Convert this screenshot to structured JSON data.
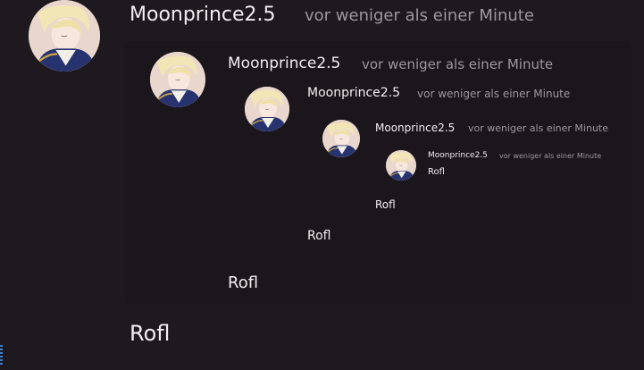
{
  "messages": [
    {
      "username": "Moonprince2.5",
      "timestamp": "vor weniger als einer Minute",
      "text": "Rofl"
    },
    {
      "username": "Moonprince2.5",
      "timestamp": "vor weniger als einer Minute",
      "text": "Rofl"
    },
    {
      "username": "Moonprince2.5",
      "timestamp": "vor weniger als einer Minute",
      "text": "Rofl"
    },
    {
      "username": "Moonprince2.5",
      "timestamp": "vor weniger als einer Minute",
      "text": "Rofl"
    },
    {
      "username": "Moonprince2.5",
      "timestamp": "vor weniger als einer Minute",
      "text": "Rofl"
    }
  ],
  "colors": {
    "background": "#1e191e",
    "username": "#f1eef1",
    "timestamp": "#9d97a0"
  },
  "icons": {
    "avatar": "user-avatar-icon"
  }
}
